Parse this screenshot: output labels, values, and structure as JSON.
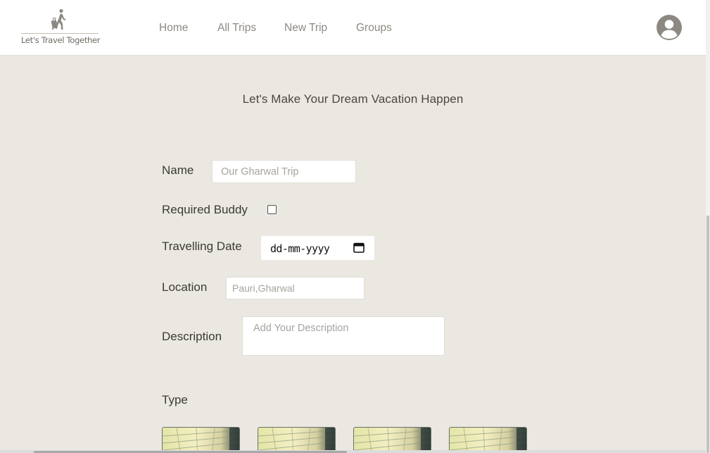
{
  "brand": {
    "tagline": "Let's Travel Together",
    "logo_icon": "traveler-with-luggage-icon",
    "color": "#8d8982"
  },
  "nav": {
    "home": "Home",
    "all_trips": "All Trips",
    "new_trip": "New Trip",
    "groups": "Groups"
  },
  "user": {
    "avatar_icon": "user-avatar-icon"
  },
  "page": {
    "title": "Let's Make Your Dream Vacation Happen"
  },
  "form": {
    "name": {
      "label": "Name",
      "placeholder": "Our Gharwal Trip",
      "value": ""
    },
    "buddy": {
      "label": "Required Buddy",
      "checked": false
    },
    "date": {
      "label": "Travelling Date",
      "value": "dd-mm-yyyy",
      "icon": "calendar-icon"
    },
    "location": {
      "label": "Location",
      "placeholder": "Pauri,Gharwal",
      "value": ""
    },
    "description": {
      "label": "Description",
      "placeholder": "Add Your Description",
      "value": ""
    },
    "type": {
      "label": "Type",
      "options_count": 4
    }
  },
  "colors": {
    "background": "#ebe8e2",
    "navbar": "#ffffff",
    "text": "#3c3a36",
    "muted": "#8d8982"
  }
}
